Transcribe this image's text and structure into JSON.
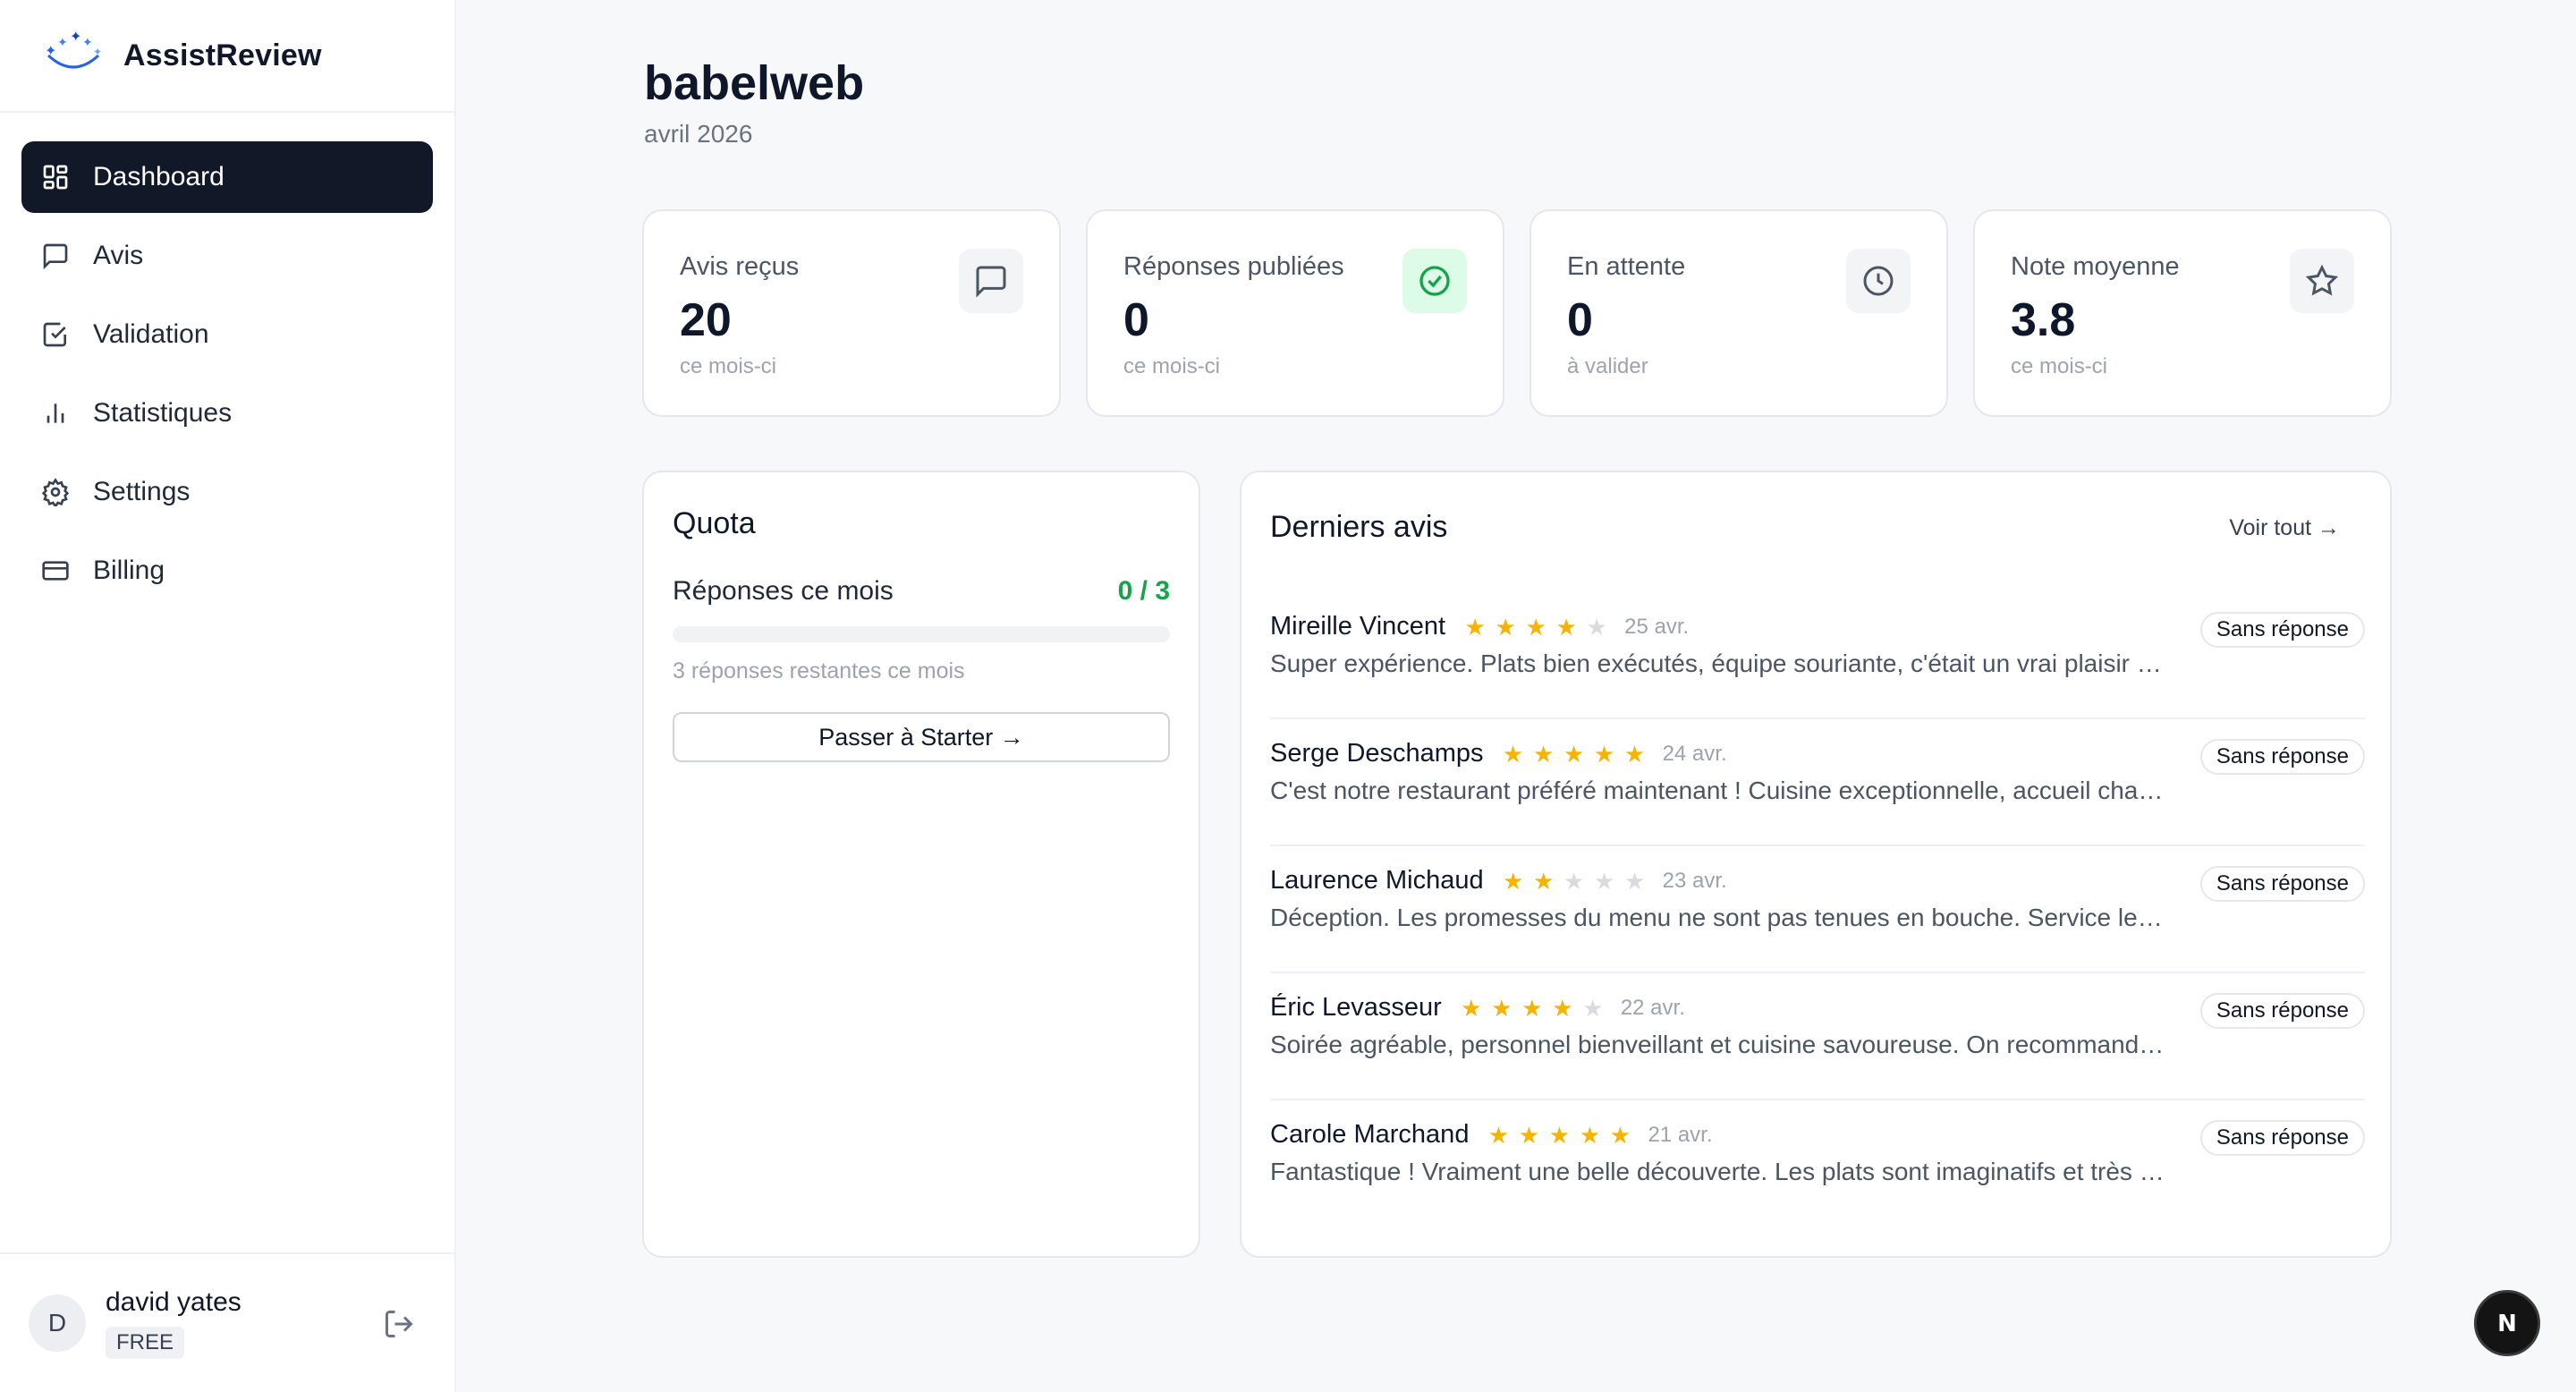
{
  "app": {
    "name": "AssistReview"
  },
  "sidebar": {
    "items": [
      {
        "label": "Dashboard",
        "icon": "dashboard-icon",
        "active": true
      },
      {
        "label": "Avis",
        "icon": "message-square-icon"
      },
      {
        "label": "Validation",
        "icon": "check-square-icon"
      },
      {
        "label": "Statistiques",
        "icon": "bar-chart-icon"
      },
      {
        "label": "Settings",
        "icon": "gear-icon"
      },
      {
        "label": "Billing",
        "icon": "credit-card-icon"
      }
    ]
  },
  "user": {
    "initial": "D",
    "name": "david yates",
    "plan": "FREE"
  },
  "header": {
    "title": "babelweb",
    "period": "avril 2026"
  },
  "stats": [
    {
      "label": "Avis reçus",
      "value": "20",
      "sub": "ce mois-ci",
      "icon": "message-square-icon"
    },
    {
      "label": "Réponses publiées",
      "value": "0",
      "sub": "ce mois-ci",
      "icon": "check-circle-icon"
    },
    {
      "label": "En attente",
      "value": "0",
      "sub": "à valider",
      "icon": "clock-icon"
    },
    {
      "label": "Note moyenne",
      "value": "3.8",
      "sub": "ce mois-ci",
      "icon": "star-icon"
    }
  ],
  "quota": {
    "title": "Quota",
    "label": "Réponses ce mois",
    "count": "0 / 3",
    "used_fraction": 0,
    "remaining": "3 réponses restantes ce mois",
    "upgrade": "Passer à Starter →"
  },
  "reviews": {
    "title": "Derniers avis",
    "see_all": "Voir tout →",
    "items": [
      {
        "author": "Mireille Vincent",
        "rating": 4,
        "date": "25 avr.",
        "text": "Super expérience. Plats bien exécutés, équipe souriante, c'était un vrai plaisir d'y dîner.",
        "status": "Sans réponse"
      },
      {
        "author": "Serge Deschamps",
        "rating": 5,
        "date": "24 avr.",
        "text": "C'est notre restaurant préféré maintenant ! Cuisine exceptionnelle, accueil chaleureux.",
        "status": "Sans réponse"
      },
      {
        "author": "Laurence Michaud",
        "rating": 2,
        "date": "23 avr.",
        "text": "Déception. Les promesses du menu ne sont pas tenues en bouche. Service lent et distrait.",
        "status": "Sans réponse"
      },
      {
        "author": "Éric Levasseur",
        "rating": 4,
        "date": "22 avr.",
        "text": "Soirée agréable, personnel bienveillant et cuisine savoureuse. On recommande vivement.",
        "status": "Sans réponse"
      },
      {
        "author": "Carole Marchand",
        "rating": 5,
        "date": "21 avr.",
        "text": "Fantastique ! Vraiment une belle découverte. Les plats sont imaginatifs et très bons.",
        "status": "Sans réponse"
      }
    ]
  },
  "fab": {
    "label": "N"
  },
  "colors": {
    "accent_dark": "#111827",
    "success": "#16a34a",
    "star": "#f5b400"
  }
}
